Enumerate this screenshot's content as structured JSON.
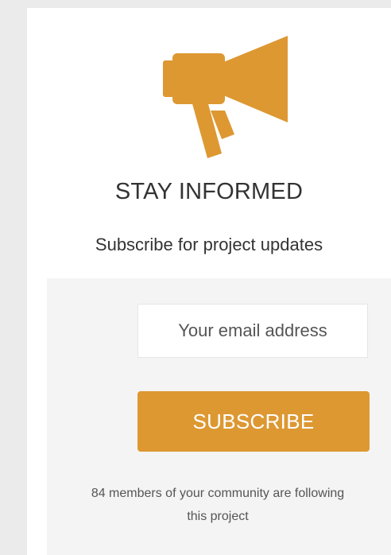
{
  "widget": {
    "icon": "megaphone-icon",
    "title": "STAY INFORMED",
    "subtitle": "Subscribe for project updates",
    "email_placeholder": "Your email address",
    "subscribe_label": "SUBSCRIBE",
    "note_line1": "84 members of your community are following",
    "note_line2": "this project"
  },
  "colors": {
    "accent": "#dd9832",
    "card_background": "#ffffff",
    "form_background": "#f4f4f4",
    "page_background": "#ebebeb",
    "text": "#333333"
  }
}
